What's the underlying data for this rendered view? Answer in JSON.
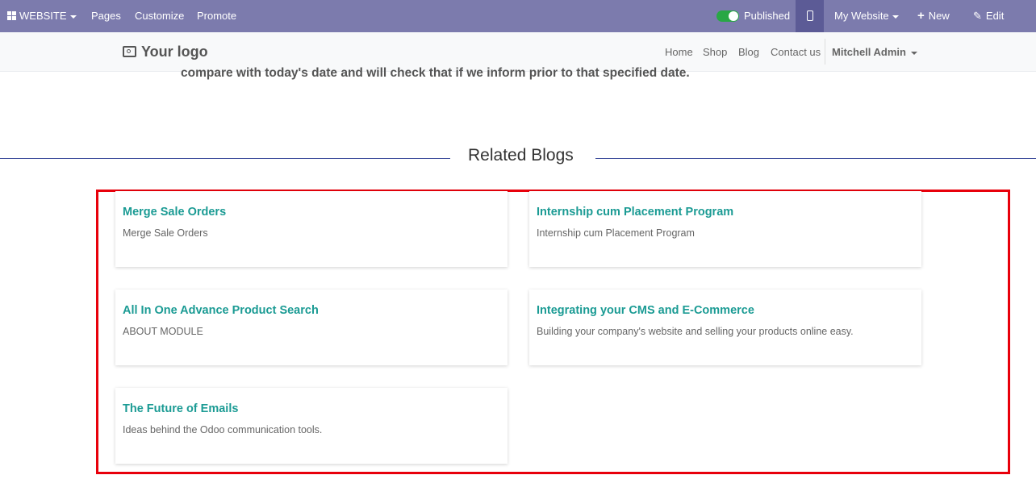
{
  "adminbar": {
    "website_label": "WEBSITE",
    "pages_label": "Pages",
    "customize_label": "Customize",
    "promote_label": "Promote",
    "published_label": "Published",
    "my_website_label": "My Website",
    "new_label": "New",
    "edit_label": "Edit"
  },
  "header": {
    "logo_text": "Your logo",
    "nav": [
      "Home",
      "Shop",
      "Blog",
      "Contact us"
    ],
    "user_name": "Mitchell Admin"
  },
  "content": {
    "cut_text": "compare with today's date and will check that if we inform prior to that specified date.",
    "related_title": "Related Blogs"
  },
  "blogs": [
    {
      "title": "Merge Sale Orders",
      "desc": "Merge Sale Orders"
    },
    {
      "title": "Internship cum Placement Program",
      "desc": "Internship cum Placement Program"
    },
    {
      "title": "All In One Advance Product Search",
      "desc": "ABOUT MODULE"
    },
    {
      "title": "Integrating your CMS and E-Commerce",
      "desc": "Building your company's website and selling your products online easy."
    },
    {
      "title": "The Future of Emails",
      "desc": "Ideas behind the Odoo communication tools."
    }
  ]
}
